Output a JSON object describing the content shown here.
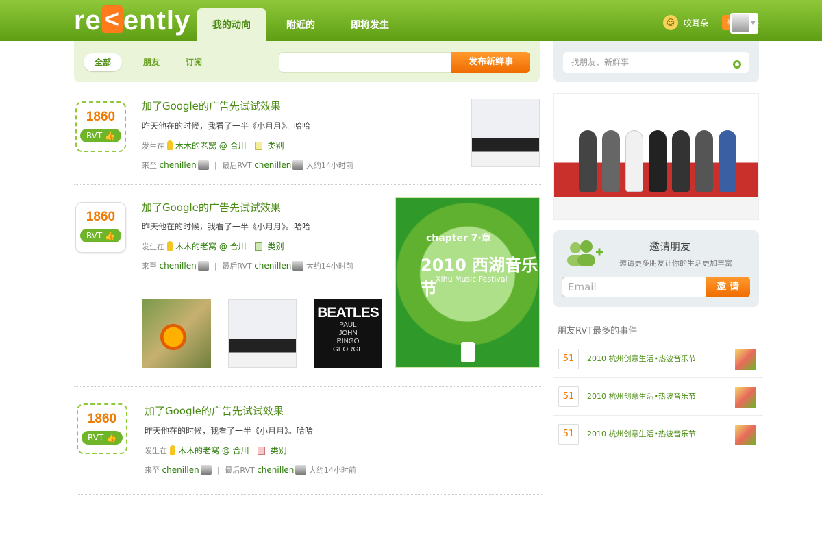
{
  "header": {
    "logo": "recently",
    "tabs": [
      {
        "label": "我的动向"
      },
      {
        "label": "附近的"
      },
      {
        "label": "即将发生"
      }
    ],
    "right_items": [
      {
        "label": "咬耳朵"
      },
      {
        "label": "足迹"
      }
    ]
  },
  "filters": {
    "items": [
      {
        "label": "全部"
      },
      {
        "label": "朋友"
      },
      {
        "label": "订阅"
      }
    ],
    "post_button": "发布新鲜事"
  },
  "feed": [
    {
      "count": "1860",
      "rvt": "RVT",
      "title": "加了Google的广告先试试效果",
      "desc": "昨天他在的时候，我看了一半《小月月》。哈哈",
      "happen": "发生在",
      "place": "木木的老窝 @ 合川",
      "category": "类别",
      "from": "来至",
      "user": "chenillen",
      "last": "最后RVT",
      "time": "大约14小时前"
    },
    {
      "count": "1860",
      "rvt": "RVT",
      "title": "加了Google的广告先试试效果",
      "desc": "昨天他在的时候，我看了一半《小月月》。哈哈",
      "happen": "发生在",
      "place": "木木的老窝 @ 合川",
      "category": "类别",
      "from": "来至",
      "user": "chenillen",
      "last": "最后RVT",
      "time": "大约14小时前"
    },
    {
      "count": "1860",
      "rvt": "RVT",
      "title": "加了Google的广告先试试效果",
      "desc": "昨天他在的时候，我看了一半《小月月》。哈哈",
      "happen": "发生在",
      "place": "木木的老窝 @ 合川",
      "category": "类别",
      "from": "来至",
      "user": "chenillen",
      "last": "最后RVT",
      "time": "大约14小时前"
    }
  ],
  "beatles": {
    "title": "BEATLES",
    "names": "PAUL\nJOHN\nRINGO\nGEORGE"
  },
  "poster": {
    "chapter": "chapter 7·章",
    "title": "2010 西湖音乐节",
    "sub": "Xihu Music Festival"
  },
  "sidebar": {
    "search_placeholder": "找朋友、新鲜事",
    "invite_title": "邀请朋友",
    "invite_sub": "邀请更多朋友让你的生活更加丰富",
    "email_placeholder": "Email",
    "invite_button": "邀 请",
    "rvt_section": "朋友RVT最多的事件",
    "events": [
      {
        "count": "51",
        "title": "2010 杭州创意生活•热波音乐节"
      },
      {
        "count": "51",
        "title": "2010 杭州创意生活•热波音乐节"
      },
      {
        "count": "51",
        "title": "2010 杭州创意生活•热波音乐节"
      }
    ]
  }
}
